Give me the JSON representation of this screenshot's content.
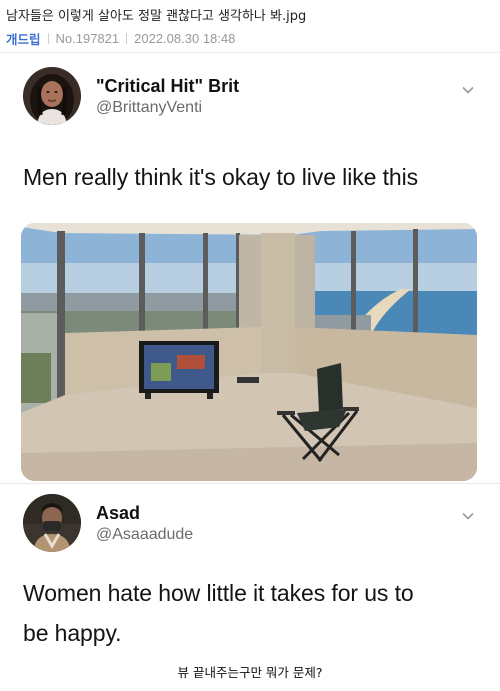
{
  "post": {
    "title": "남자들은 이렇게 살아도 정말 괜찮다고 생각하나 봐.jpg",
    "board": "개드립",
    "number": "No.197821",
    "datetime": "2022.08.30 18:48"
  },
  "tweet": {
    "display_name": "\"Critical Hit\" Brit",
    "handle": "@BrittanyVenti",
    "text": "Men really think it's okay to live like this",
    "photo_icon": "apartment-room-photo"
  },
  "reply": {
    "display_name": "Asad",
    "handle": "@Asaaadude",
    "text_line1": "Women hate how little it takes for us to",
    "text_line2": "be happy."
  },
  "caption": "뷰 끝내주는구만 뭐가 문제?",
  "colors": {
    "board_link": "#3a6fd6",
    "meta_gray": "#999999",
    "handle_gray": "#6b6b6b"
  }
}
